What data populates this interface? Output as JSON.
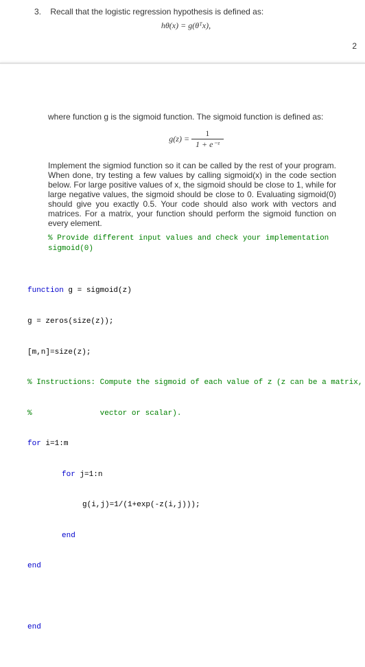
{
  "question": {
    "number": "3.",
    "intro": "Recall that the logistic regression hypothesis is defined as:",
    "formula_h": "hθ(x) = g(θᵀx),",
    "page_number": "2",
    "sigmoid_intro": "where function g is the sigmoid function. The sigmoid function is defined as:",
    "formula_g_lhs": "g(z) = ",
    "formula_g_num": "1",
    "formula_g_den": "1 + e⁻ᶻ",
    "body": "Implement the sigmiod function so it can be called by the rest of your program. When done, try testing a few values by calling sigmoid(x) in the code section below. For large positive values of x, the sigmoid should be close to 1, while for large negative values, the sigmoid should be close to 0. Evaluating sigmoid(0) should give you exactly 0.5. Your code should also work with vectors and matrices. For a matrix, your function should perform the sigmoid function on every element.",
    "comment1": "% Provide different input values and check your implementation",
    "comment2": "sigmoid(0)"
  },
  "code": {
    "l1_kw": "function",
    "l1_rest": " g = sigmoid(z)",
    "l2": "g = zeros(size(z));",
    "l3": "[m,n]=size(z);",
    "l4": "% Instructions: Compute the sigmoid of each value of z (z can be a matrix,",
    "l5": "%               vector or scalar).",
    "l6_kw": "for",
    "l6_rest": " i=1:m",
    "l7_kw": "for",
    "l7_rest": " j=1:n",
    "l8": "g(i,j)=1/(1+exp(-z(i,j)));",
    "l9": "end",
    "l10": "end",
    "l11": "end"
  }
}
